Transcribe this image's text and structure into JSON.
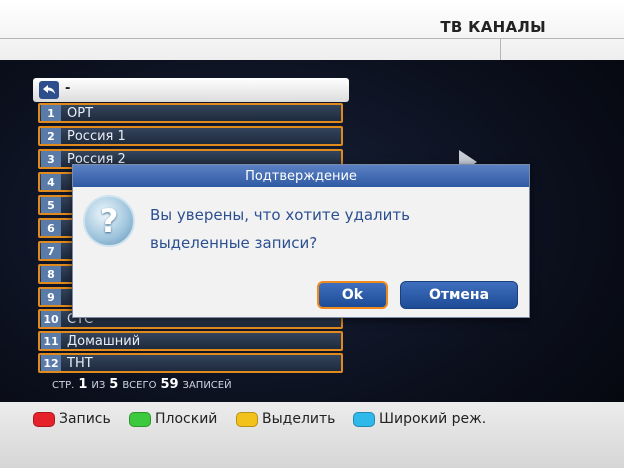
{
  "header": {
    "title": "ТВ КАНАЛЫ"
  },
  "path": {
    "text": "-"
  },
  "channels": [
    {
      "num": "1",
      "name": "ОРТ"
    },
    {
      "num": "2",
      "name": "Россия 1"
    },
    {
      "num": "3",
      "name": "Россия 2"
    },
    {
      "num": "4",
      "name": ""
    },
    {
      "num": "5",
      "name": ""
    },
    {
      "num": "6",
      "name": ""
    },
    {
      "num": "7",
      "name": ""
    },
    {
      "num": "8",
      "name": ""
    },
    {
      "num": "9",
      "name": ""
    },
    {
      "num": "10",
      "name": "СТС"
    },
    {
      "num": "11",
      "name": "Домашний"
    },
    {
      "num": "12",
      "name": "ТНТ"
    }
  ],
  "pageinfo": {
    "str": "СТР.",
    "page": "1",
    "of": "ИЗ",
    "total_pages": "5",
    "all": "ВСЕГО",
    "records": "59",
    "records_label": "ЗАПИСЕЙ"
  },
  "dialog": {
    "title": "Подтверждение",
    "line1": "Вы уверены, что хотите удалить",
    "line2": "выделенные записи?",
    "ok": "Ok",
    "cancel": "Отмена",
    "icon": "question-icon"
  },
  "keys": [
    {
      "label": "Запись",
      "color": "#e52229"
    },
    {
      "label": "Плоский",
      "color": "#3dc93d"
    },
    {
      "label": "Выделить",
      "color": "#f2c21b"
    },
    {
      "label": "Широкий реж.",
      "color": "#2fb8ea"
    }
  ]
}
